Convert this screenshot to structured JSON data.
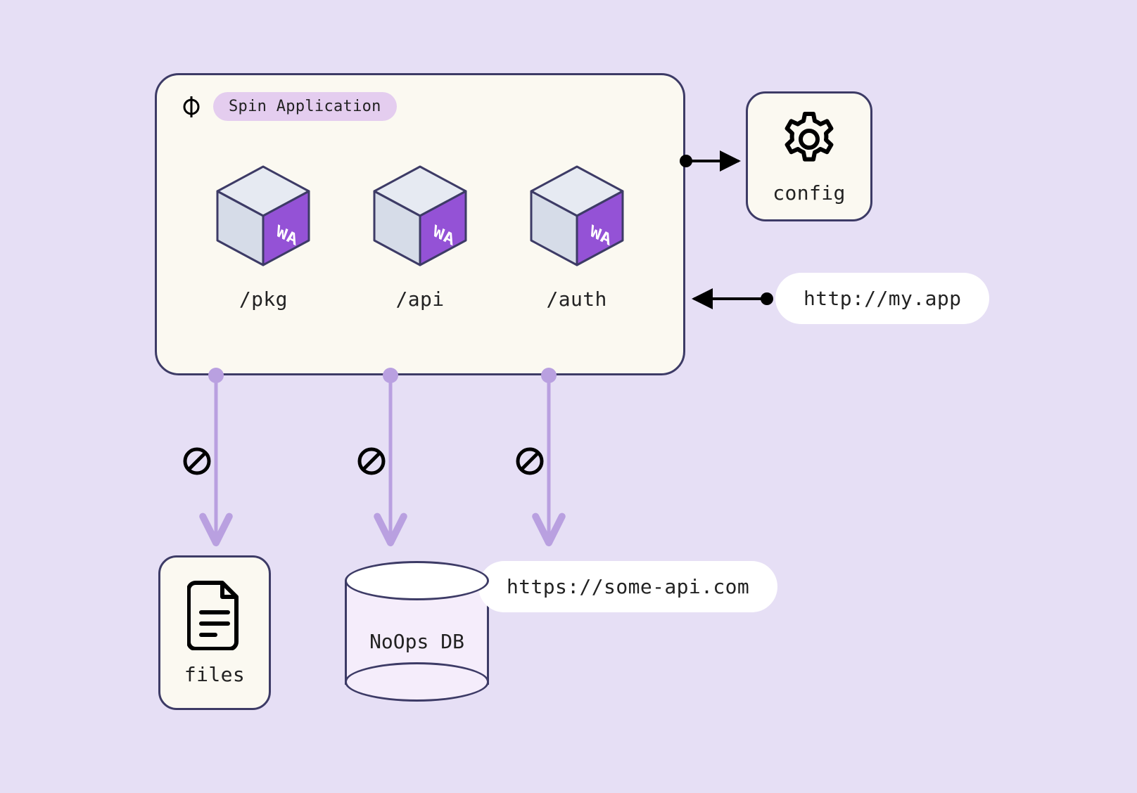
{
  "app": {
    "title": "Spin Application",
    "components": [
      {
        "path": "/pkg",
        "badge": "WA"
      },
      {
        "path": "/api",
        "badge": "WA"
      },
      {
        "path": "/auth",
        "badge": "WA"
      }
    ]
  },
  "config": {
    "label": "config"
  },
  "incoming_url": "http://my.app",
  "blocked": {
    "files_label": "files",
    "db_label": "NoOps DB",
    "api_url": "https://some-api.com"
  },
  "colors": {
    "bg": "#e6dff5",
    "panel": "#fbf9f1",
    "border": "#3d3b66",
    "accent": "#a174e8",
    "cube_face": "#9452d6",
    "cube_top": "#e6eaf2",
    "arrow_light": "#b9a0e0"
  }
}
